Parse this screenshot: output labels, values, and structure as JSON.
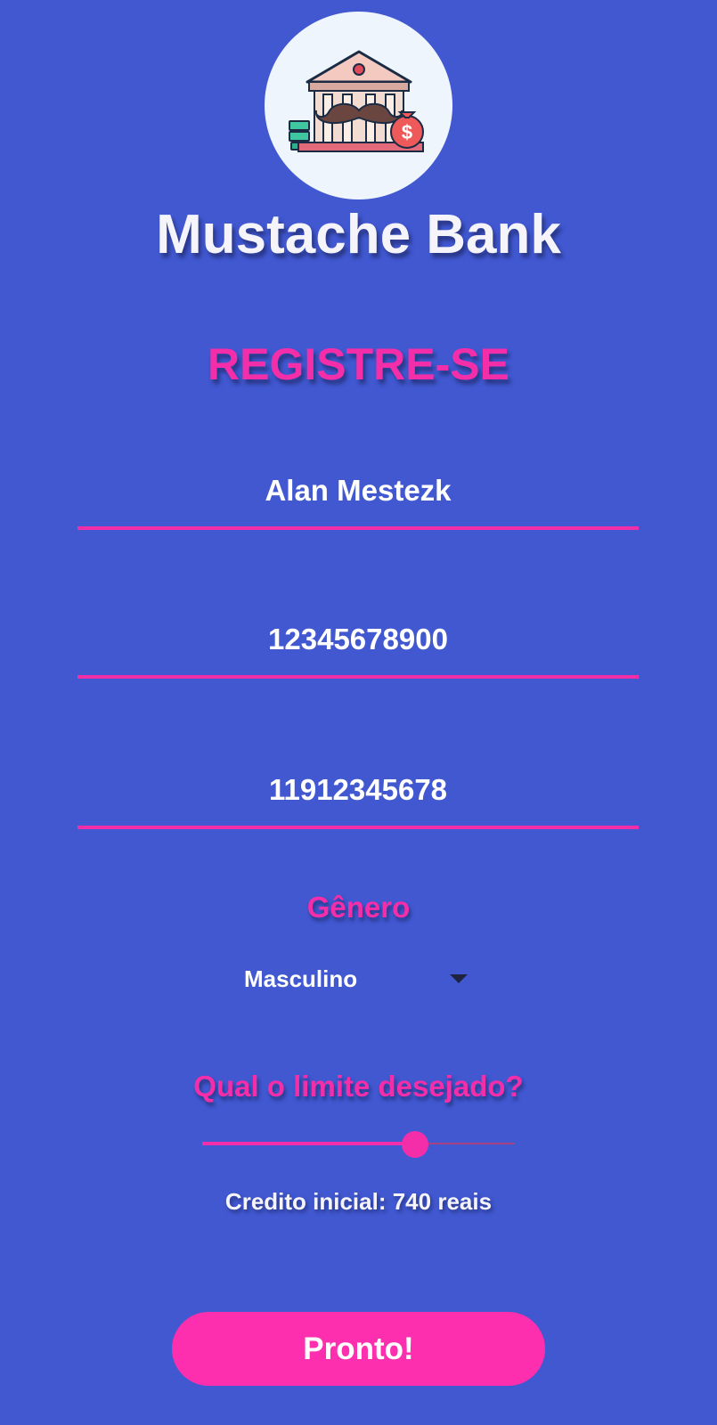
{
  "app": {
    "title": "Mustache Bank",
    "logo_icon": "bank-with-mustache-icon"
  },
  "page": {
    "heading": "REGISTRE-SE"
  },
  "form": {
    "name_value": "Alan Mestezk",
    "cpf_value": "12345678900",
    "phone_value": "11912345678",
    "gender_label": "Gênero",
    "gender_selected": "Masculino",
    "limit_label": "Qual o limite desejado?",
    "limit_slider_fraction": 0.68,
    "credit_text": "Credito inicial: 740 reais",
    "submit_label": "Pronto!"
  },
  "colors": {
    "background": "#4158d1",
    "accent": "#f42ea8",
    "button": "#fd2fae",
    "text": "#ffffff"
  }
}
